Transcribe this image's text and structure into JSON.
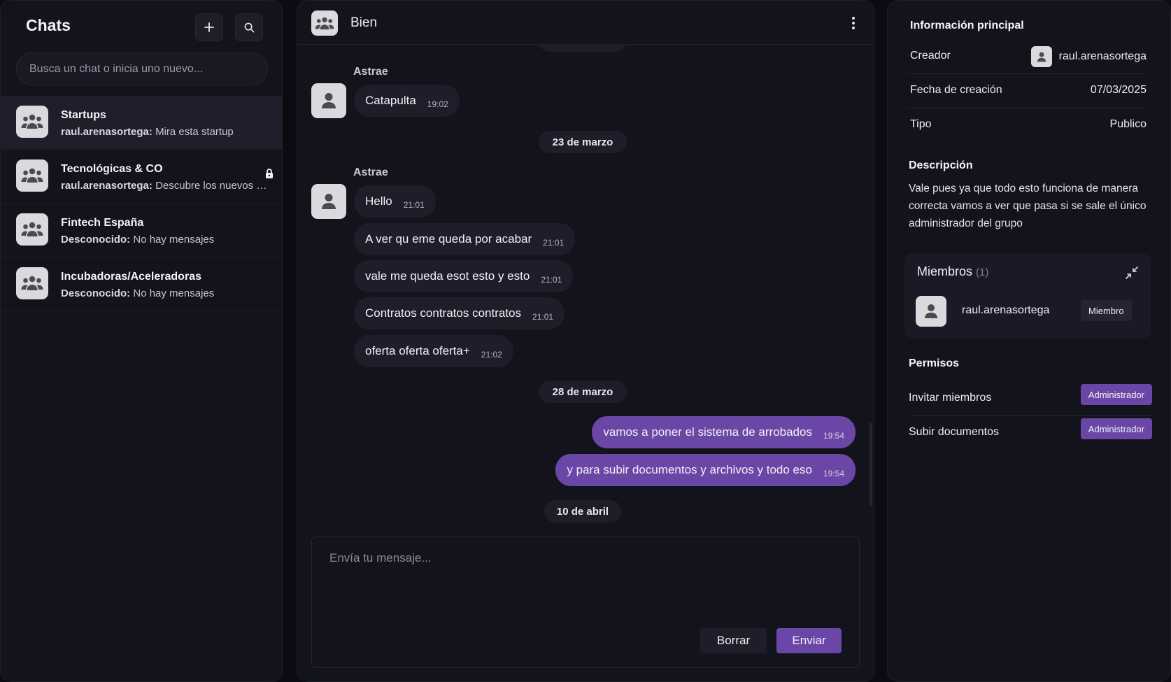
{
  "sidebar": {
    "title": "Chats",
    "search_placeholder": "Busca un chat o inicia uno nuevo...",
    "chats": [
      {
        "name": "Startups",
        "sender": "raul.arenasortega:",
        "preview": "Mira esta startup",
        "active": true,
        "locked": false
      },
      {
        "name": "Tecnológicas & CO",
        "sender": "raul.arenasortega:",
        "preview": "Descubre los nuevos modelos de IA",
        "active": false,
        "locked": true
      },
      {
        "name": "Fintech España",
        "sender": "Desconocido:",
        "preview": "No hay mensajes",
        "active": false,
        "locked": false
      },
      {
        "name": "Incubadoras/Aceleradoras",
        "sender": "Desconocido:",
        "preview": "No hay mensajes",
        "active": false,
        "locked": false
      }
    ]
  },
  "chat": {
    "title": "Bien",
    "messages": [
      {
        "sender": "Astrae",
        "text": "Catapulta",
        "time": "19:02"
      },
      {
        "date": "23 de marzo"
      },
      {
        "sender": "Astrae",
        "text": "Hello",
        "time": "21:01"
      },
      {
        "text": "A ver qu eme queda por acabar",
        "time": "21:01"
      },
      {
        "text": "vale me queda esot esto y esto",
        "time": "21:01"
      },
      {
        "text": "Contratos contratos contratos",
        "time": "21:01"
      },
      {
        "text": "oferta oferta oferta+",
        "time": "21:02"
      },
      {
        "date": "28 de marzo"
      },
      {
        "mine": true,
        "text": "vamos a poner el sistema de arrobados",
        "time": "19:54"
      },
      {
        "mine": true,
        "text": "y para subir documentos y archivos y todo eso",
        "time": "19:54"
      },
      {
        "date": "10 de abril"
      }
    ],
    "composer": {
      "placeholder": "Envía tu mensaje...",
      "clear_label": "Borrar",
      "send_label": "Enviar"
    }
  },
  "details": {
    "main_title": "Información principal",
    "creator_label": "Creador",
    "creator_value": "raul.arenasortega",
    "date_label": "Fecha de creación",
    "date_value": "07/03/2025",
    "type_label": "Tipo",
    "type_value": "Publico",
    "description_title": "Descripción",
    "description": "Vale pues ya que todo esto funciona de manera correcta vamos a ver que pasa si se sale el único administrador del grupo",
    "members_title": "Miembros",
    "members_count": "(1)",
    "members": [
      {
        "name": "raul.arenasortega",
        "role": "Miembro"
      }
    ],
    "permissions_title": "Permisos",
    "permissions": [
      {
        "label": "Invitar miembros",
        "value": "Administrador"
      },
      {
        "label": "Subir documentos",
        "value": "Administrador"
      }
    ]
  },
  "colors": {
    "accent": "#6a47a6",
    "background": "#0b0c12",
    "panel": "#12131b"
  },
  "icons": [
    "plus-icon",
    "search-icon",
    "group-icon",
    "lock-icon",
    "kebab-icon",
    "user-icon",
    "collapse-icon"
  ]
}
